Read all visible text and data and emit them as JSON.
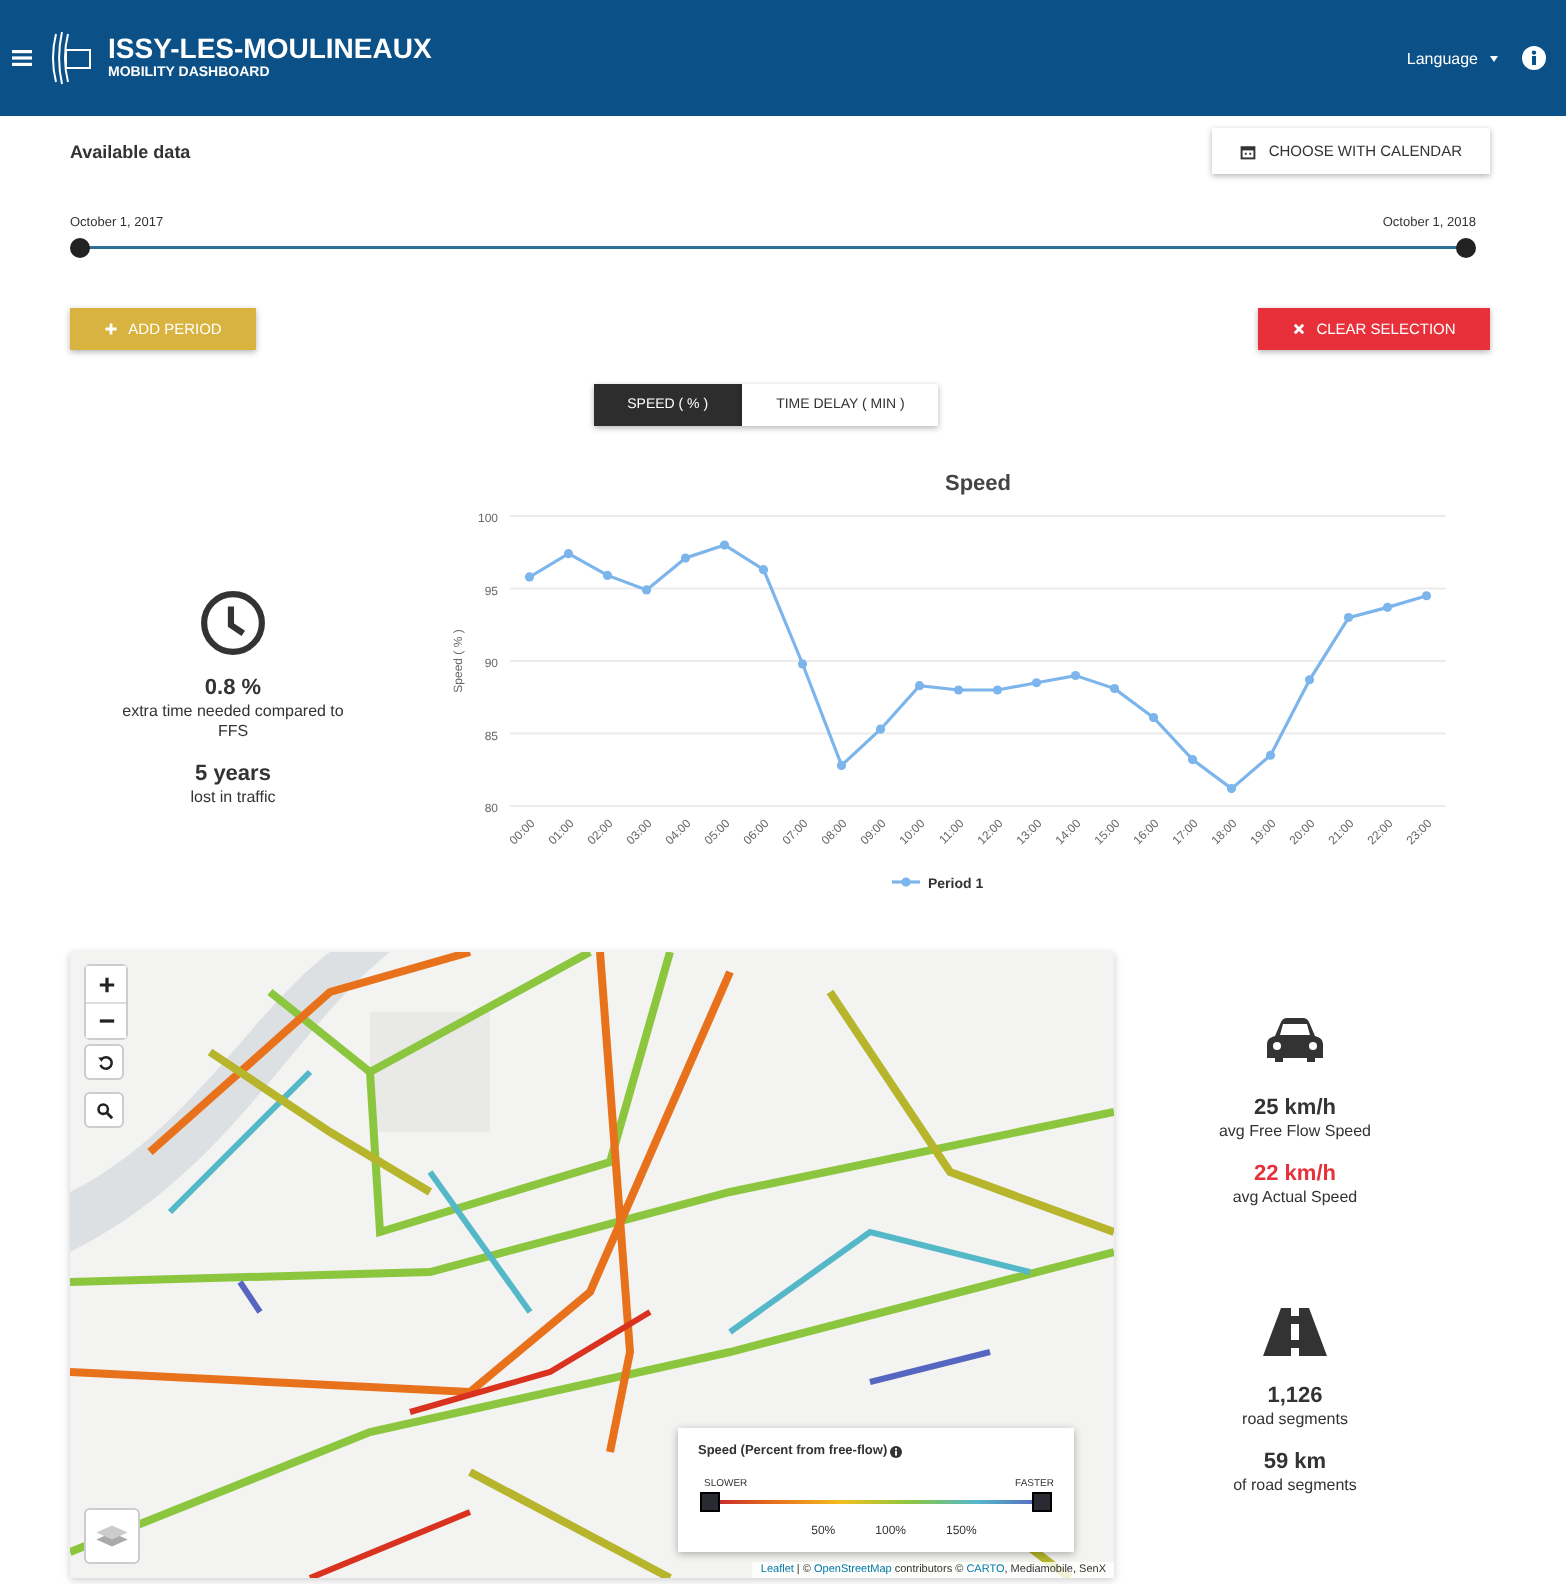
{
  "header": {
    "title": "ISSY-LES-MOULINEAUX",
    "subtitle": "MOBILITY DASHBOARD",
    "language": "Language"
  },
  "available": {
    "label": "Available data",
    "calendar_button": "CHOOSE WITH CALENDAR",
    "start": "October 1, 2017",
    "end": "October 1, 2018",
    "handles": [
      {
        "level": 0
      },
      {
        "level": 1
      }
    ]
  },
  "actions": {
    "add": "ADD PERIOD",
    "clear": "CLEAR SELECTION"
  },
  "tabs": [
    {
      "label": "SPEED ( % )",
      "selected": true
    },
    {
      "label": "TIME DELAY ( MIN )",
      "selected": false
    }
  ],
  "time_stats": [
    {
      "value": "0.8 %",
      "caption": "extra time needed compared to FFS"
    },
    {
      "value": "5 years",
      "caption": "lost in traffic"
    }
  ],
  "chart": {
    "chart_data": {
      "type": "line",
      "title": "Speed",
      "ylabel": "Speed ( % )",
      "categories": [
        "00:00",
        "01:00",
        "02:00",
        "03:00",
        "04:00",
        "05:00",
        "06:00",
        "07:00",
        "08:00",
        "09:00",
        "10:00",
        "11:00",
        "12:00",
        "13:00",
        "14:00",
        "15:00",
        "16:00",
        "17:00",
        "18:00",
        "19:00",
        "20:00",
        "21:00",
        "22:00",
        "23:00"
      ],
      "ylim": [
        80,
        100
      ],
      "yticks": [
        80,
        85,
        90,
        95,
        100
      ],
      "grid": true,
      "series": [
        {
          "name": "Period 1",
          "color": "#7cb5ec",
          "marker": true,
          "values": [
            95.8,
            97.4,
            95.9,
            94.9,
            97.1,
            98.0,
            96.3,
            89.8,
            82.8,
            85.3,
            88.3,
            88.0,
            88.0,
            88.5,
            89.0,
            88.1,
            86.1,
            83.2,
            81.2,
            83.5,
            88.7,
            93.0,
            93.7,
            94.5
          ]
        }
      ]
    }
  },
  "map": {
    "legend": {
      "title": "Speed (Percent from free-flow)",
      "slower": "SLOWER",
      "faster": "FASTER",
      "ticks": [
        "50%",
        "100%",
        "150%"
      ],
      "handles": [
        {
          "level": 0
        },
        {
          "level": 1
        }
      ]
    },
    "attribution": [
      {
        "text": "Leaflet",
        "link": true
      },
      {
        "text": " | © ",
        "link": false
      },
      {
        "text": "OpenStreetMap",
        "link": true
      },
      {
        "text": " contributors © ",
        "link": false
      },
      {
        "text": "CARTO",
        "link": true
      },
      {
        "text": ", Mediamobile, SenX",
        "link": false
      }
    ]
  },
  "speed_stats": [
    {
      "value": "25 km/h",
      "caption": "avg Free Flow Speed",
      "alert": false
    },
    {
      "value": "22 km/h",
      "caption": "avg Actual Speed",
      "alert": true
    }
  ],
  "road_stats": [
    {
      "value": "1,126",
      "caption": "road segments"
    },
    {
      "value": "59 km",
      "caption": "of road segments"
    }
  ]
}
